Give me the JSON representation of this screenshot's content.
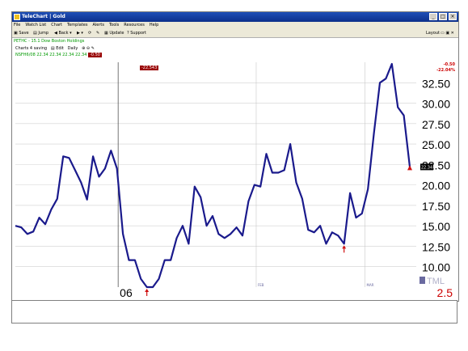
{
  "window": {
    "title": "TeleChart | Gold",
    "controls": [
      "_",
      "□",
      "×"
    ]
  },
  "menu": [
    "File",
    "Watch List",
    "Chart",
    "Templates",
    "Alerts",
    "Tools",
    "Resources",
    "Help"
  ],
  "toolbar": {
    "items": [
      "Save",
      "Jump",
      "Back",
      "Update",
      "Support"
    ],
    "right": "Layout"
  },
  "chart_header": {
    "symbol_line": "PETHC - 15.1 Dow Boston Holdings",
    "charts_label": "Charts 4 saving",
    "edit_label": "Edit",
    "daily_label": "Daily",
    "quote_line": "NSFH6/08  22.34  22.34  22.34  22.34",
    "red_box_1": "-0.50",
    "red_box_2": "-22,543",
    "change": "-0.50",
    "change_pct": "-22.04%",
    "last_price_tag": "22.34"
  },
  "chart_data": {
    "type": "line",
    "title": "",
    "xlabel": "",
    "ylabel": "",
    "ylim": [
      7.5,
      35
    ],
    "yticks": [
      "32.50",
      "30.00",
      "27.50",
      "25.00",
      "22.50",
      "20.00",
      "17.50",
      "15.00",
      "12.50",
      "10.00"
    ],
    "x_markers": [
      "06",
      "FEB",
      "MAR"
    ],
    "series": [
      {
        "color": "#1a1a8c",
        "values": [
          15.0,
          14.8,
          14.0,
          14.3,
          16.0,
          15.2,
          17.0,
          18.3,
          23.5,
          23.3,
          21.8,
          20.3,
          18.2,
          23.5,
          21.0,
          22.0,
          24.2,
          22.0,
          14.0,
          10.8,
          10.8,
          8.5,
          7.5,
          7.5,
          8.5,
          10.8,
          10.8,
          13.5,
          15.0,
          12.8,
          19.8,
          18.5,
          15.0,
          16.2,
          14.0,
          13.5,
          14.0,
          14.8,
          13.8,
          18.0,
          20.0,
          19.8,
          23.8,
          21.5,
          21.5,
          21.8,
          25.0,
          20.3,
          18.3,
          14.5,
          14.2,
          15.0,
          12.8,
          14.2,
          13.8,
          12.8,
          19.0,
          16.0,
          16.5,
          19.5,
          26.3,
          32.5,
          33.0,
          34.8,
          29.5,
          28.5,
          22.2
        ]
      }
    ],
    "signal_arrows": [
      {
        "index": 22,
        "value": 7.5
      },
      {
        "index": 55,
        "value": 12.8
      },
      {
        "index": 66,
        "value": 22.2
      }
    ],
    "right_labels": {
      "big": "TML",
      "small": "2.5"
    }
  }
}
